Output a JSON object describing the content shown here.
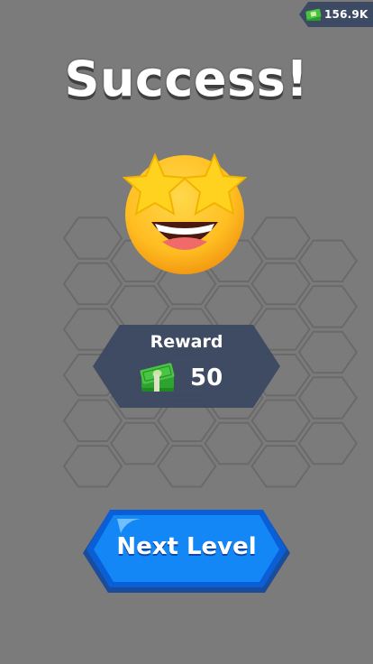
{
  "hud": {
    "currency_icon": "cash-stack-icon",
    "currency_amount": "156.9K"
  },
  "title": "Success!",
  "emoji": "star-struck-face-icon",
  "reward": {
    "label": "Reward",
    "icon": "cash-stack-icon",
    "amount": "50"
  },
  "next_button": {
    "label": "Next Level"
  },
  "colors": {
    "background": "#7b7b7b",
    "panel": "#3c4a63",
    "button": "#0f7cf0",
    "button_border": "#0b4fb8",
    "money_green": "#35b534"
  }
}
